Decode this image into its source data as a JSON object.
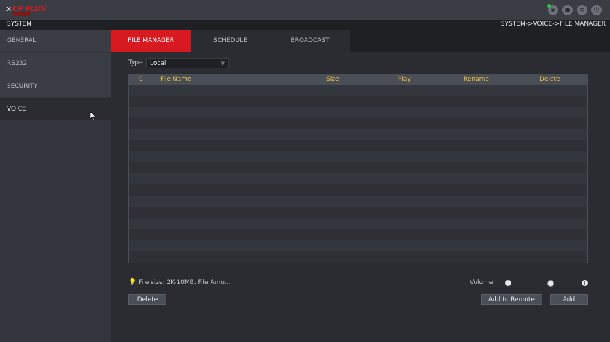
{
  "header": {
    "logo_text": "CP PLUS",
    "logo_sub": "",
    "icons": [
      "eye-icon",
      "user-icon",
      "menu-icon",
      "power-icon"
    ]
  },
  "system_bar": {
    "title": "SYSTEM",
    "breadcrumb": "SYSTEM->VOICE->FILE MANAGER"
  },
  "sidebar": {
    "items": [
      {
        "label": "GENERAL"
      },
      {
        "label": "RS232"
      },
      {
        "label": "SECURITY"
      },
      {
        "label": "VOICE"
      }
    ],
    "active_index": 3
  },
  "tabs": [
    {
      "label": "FILE MANAGER"
    },
    {
      "label": "SCHEDULE"
    },
    {
      "label": "BROADCAST"
    }
  ],
  "type_field": {
    "label": "Type",
    "value": "Local"
  },
  "table": {
    "headers": [
      "0",
      "File Name",
      "Size",
      "Play",
      "Rename",
      "Delete"
    ],
    "rows": []
  },
  "hint_text": "File size: 2K-10MB. File Amo...",
  "volume": {
    "label": "Volume",
    "level": 0.55
  },
  "buttons": {
    "delete": "Delete",
    "add_to_remote": "Add to Remote",
    "add": "Add"
  },
  "colors": {
    "accent": "#d71920",
    "header_text": "#f0c040"
  }
}
